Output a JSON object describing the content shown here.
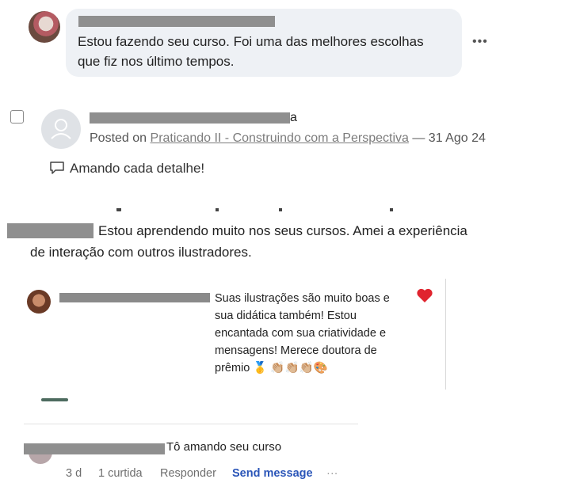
{
  "comment1": {
    "text_line1": "Estou fazendo seu curso. Foi uma das melhores escolhas",
    "text_line2": "que fiz nos último tempos.",
    "more_icon": "more-horizontal-icon"
  },
  "post": {
    "author_suffix": "a",
    "posted_prefix": "Posted on",
    "course_link": "Praticando II - Construindo com a Perspectiva",
    "separator": "—",
    "date": "31 Ago 24",
    "comment_icon": "comment-bubble-icon",
    "comment_text": "Amando cada detalhe!"
  },
  "story": {
    "line1": "Estou aprendendo muito nos seus cursos. Amei a experiência",
    "line2": "de interação com outros ilustradores."
  },
  "insta": {
    "line1": "Suas ilustrações são muito boas e",
    "line2": "sua didática também! Estou",
    "line3": "encantada com sua criatividade e",
    "line4": "mensagens! Merece doutora de",
    "line5": "prêmio 🥇 👏🏼👏🏼👏🏼🎨",
    "heart_icon": "heart-icon",
    "heart_color": "#e0242e"
  },
  "reply": {
    "text": "Tô amando seu curso",
    "time": "3 d",
    "likes": "1 curtida",
    "reply_label": "Responder",
    "send_label": "Send message",
    "more": "···",
    "send_color": "#2a55b8"
  }
}
